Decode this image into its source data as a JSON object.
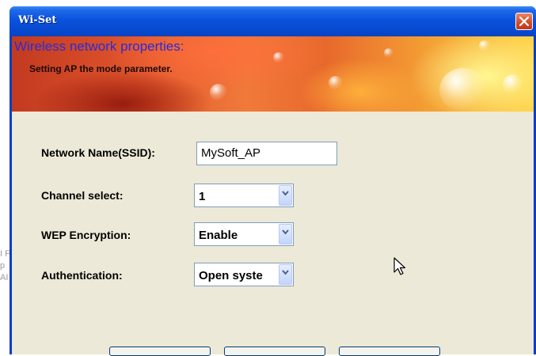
{
  "window": {
    "title": "Wi-Set"
  },
  "banner": {
    "title": "Wireless network properties:",
    "subtitle": "Setting AP the mode parameter."
  },
  "form": {
    "ssid_label": "Network Name(SSID):",
    "ssid_value": "MySoft_AP",
    "channel_label": "Channel select:",
    "channel_value": "1",
    "wep_label": "WEP Encryption:",
    "wep_value": "Enable",
    "auth_label": "Authentication:",
    "auth_value": "Open syste"
  },
  "background_text": [
    "I F",
    "p",
    "AI"
  ],
  "colors": {
    "titlebar": "#0a52dc",
    "client": "#ece9d8",
    "banner_title": "#2a2cd8",
    "close": "#d34a24"
  }
}
